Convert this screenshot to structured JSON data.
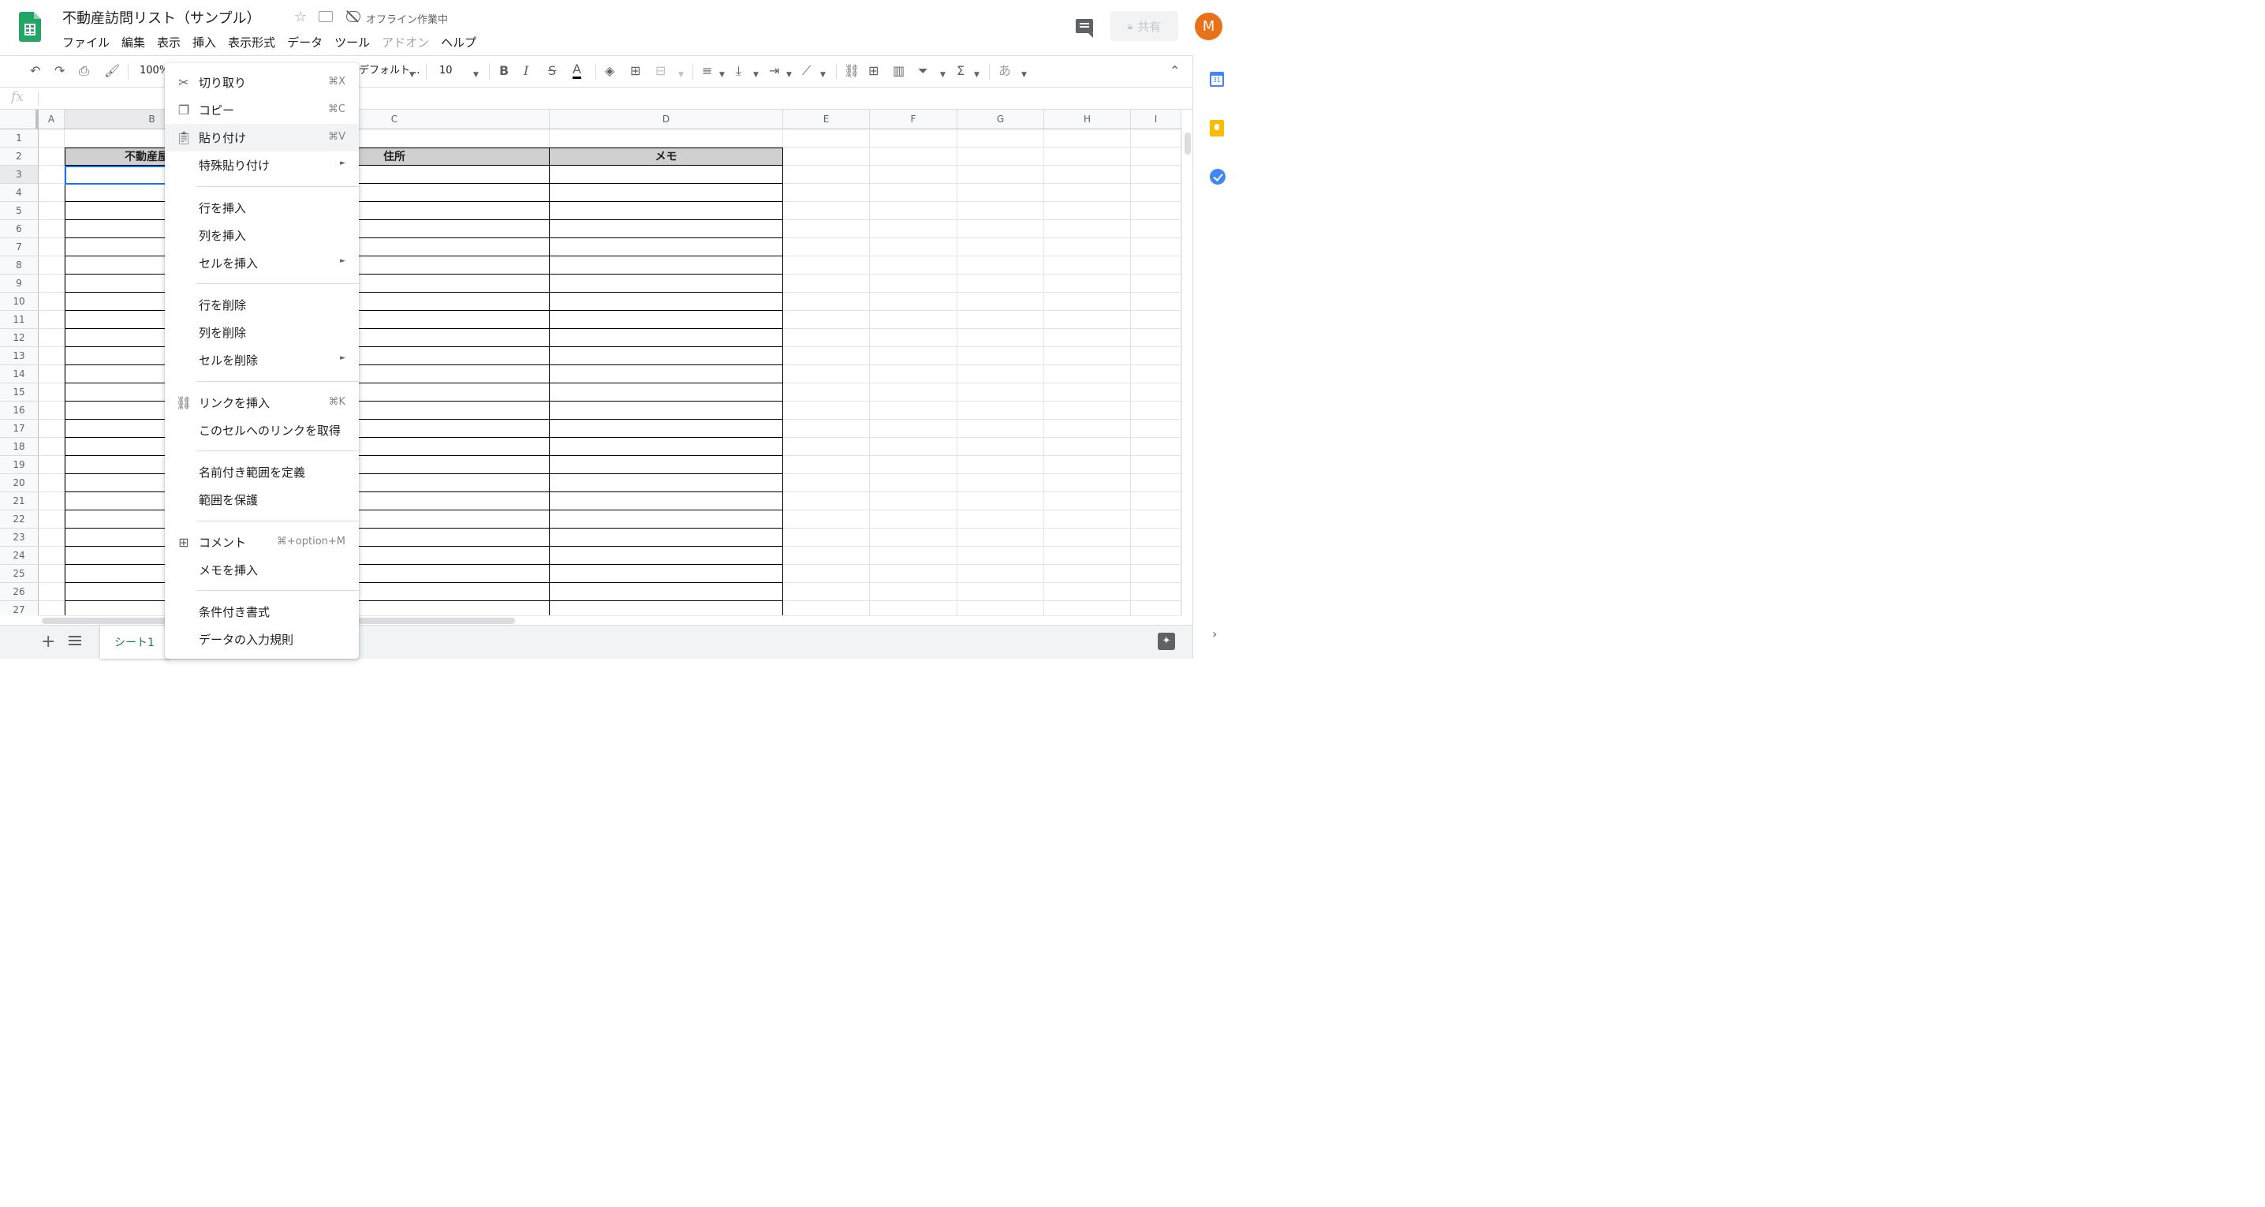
{
  "doc": {
    "title": "不動産訪問リスト（サンプル）",
    "offline_status": "オフライン作業中"
  },
  "menubar": [
    "ファイル",
    "編集",
    "表示",
    "挿入",
    "表示形式",
    "データ",
    "ツール",
    "アドオン",
    "ヘルプ"
  ],
  "header": {
    "share_label": "共有",
    "avatar_initial": "M"
  },
  "toolbar": {
    "zoom": "100%",
    "font": "デフォルト...",
    "font_size": "10",
    "bold": "B",
    "italic": "I",
    "strike": "S",
    "text_color": "A",
    "input_tool": "あ"
  },
  "formula_bar": {
    "fx": "fx"
  },
  "columns": [
    "A",
    "B",
    "C",
    "D",
    "E",
    "F",
    "G",
    "H",
    "I"
  ],
  "rows": [
    "1",
    "2",
    "3",
    "4",
    "5",
    "6",
    "7",
    "8",
    "9",
    "10",
    "11",
    "12",
    "13",
    "14",
    "15",
    "16",
    "17",
    "18",
    "19",
    "20",
    "21",
    "22",
    "23",
    "24",
    "25",
    "26",
    "27"
  ],
  "table": {
    "headers": [
      "不動産屋の",
      "住所",
      "メモ"
    ]
  },
  "sheet_tab": "シート1",
  "side_panel": {
    "calendar_day": "31"
  },
  "context_menu": {
    "items": [
      {
        "label": "切り取り",
        "shortcut": "⌘X",
        "icon": "scissors-icon"
      },
      {
        "label": "コピー",
        "shortcut": "⌘C",
        "icon": "copy-icon"
      },
      {
        "label": "貼り付け",
        "shortcut": "⌘V",
        "icon": "paste-icon"
      },
      {
        "label": "特殊貼り付け",
        "submenu": true
      },
      {
        "label": "行を挿入"
      },
      {
        "label": "列を挿入"
      },
      {
        "label": "セルを挿入",
        "submenu": true
      },
      {
        "label": "行を削除"
      },
      {
        "label": "列を削除"
      },
      {
        "label": "セルを削除",
        "submenu": true
      },
      {
        "label": "リンクを挿入",
        "shortcut": "⌘K",
        "icon": "link-icon"
      },
      {
        "label": "このセルへのリンクを取得"
      },
      {
        "label": "名前付き範囲を定義"
      },
      {
        "label": "範囲を保護"
      },
      {
        "label": "コメント",
        "shortcut": "⌘+option+M",
        "icon": "comment-add-icon"
      },
      {
        "label": "メモを挿入"
      },
      {
        "label": "条件付き書式"
      },
      {
        "label": "データの入力規則"
      }
    ],
    "submenu_arrow": "►"
  },
  "colors": {
    "accent_green": "#188038",
    "selection_blue": "#1a73e8",
    "avatar_orange": "#e8711a",
    "table_header_gray": "#d0d0d0"
  }
}
